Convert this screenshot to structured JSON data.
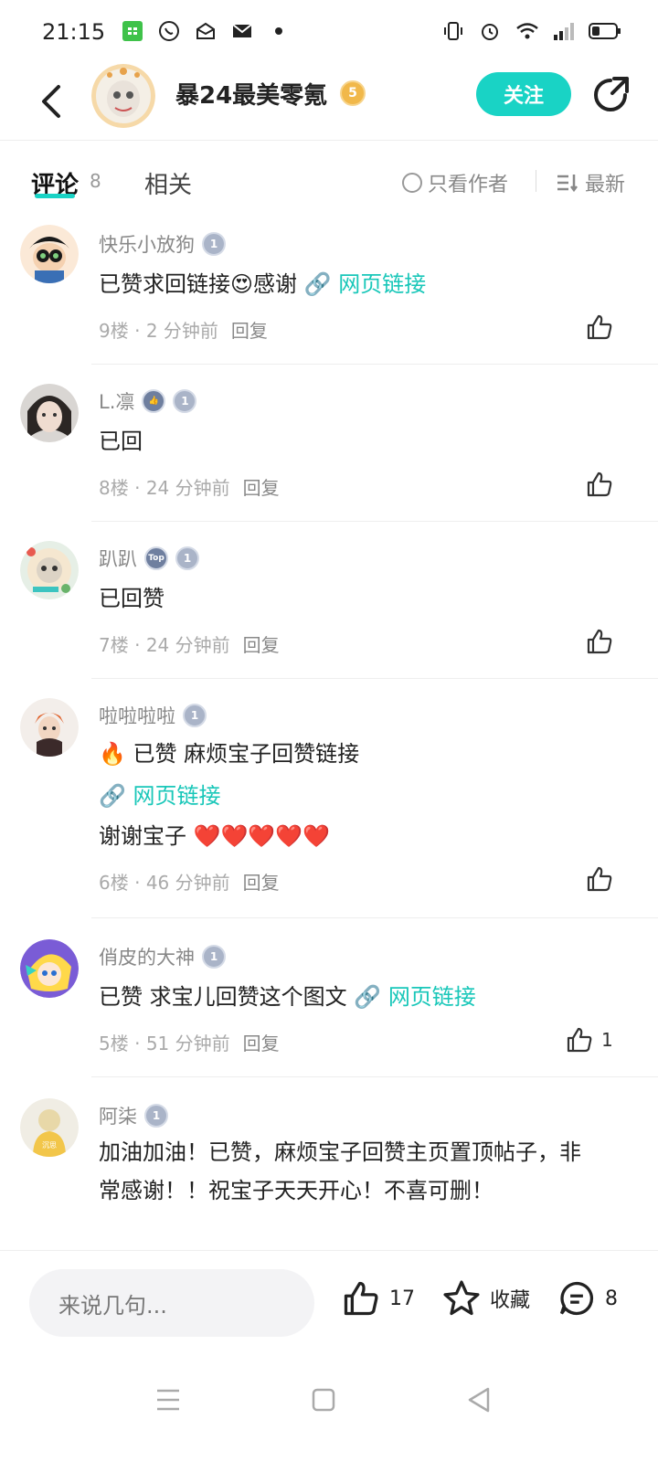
{
  "status_bar": {
    "time": "21:15",
    "left_icons": [
      "calculator-icon",
      "whatsapp-icon",
      "mail-open-icon",
      "mail-icon",
      "dot-icon"
    ],
    "right_icons": [
      "vibrate-icon",
      "alarm-icon",
      "wifi-icon",
      "signal-icon",
      "battery-icon"
    ]
  },
  "header": {
    "title": "暴24最美零氪",
    "level_badge": "5",
    "follow_label": "关注"
  },
  "tabs": {
    "comments_label": "评论",
    "comments_count": "8",
    "related_label": "相关",
    "only_author_label": "只看作者",
    "sort_label": "最新"
  },
  "comments": [
    {
      "name": "快乐小放狗",
      "badges": [
        "1"
      ],
      "body": "已赞求回链接😍感谢",
      "link_label": "网页链接",
      "floor": "9楼",
      "time": "2 分钟前",
      "reply": "回复",
      "likes": ""
    },
    {
      "name": "L.凛",
      "badges": [
        "like",
        "1"
      ],
      "body": "已回",
      "floor": "8楼",
      "time": "24 分钟前",
      "reply": "回复",
      "likes": ""
    },
    {
      "name": "趴趴",
      "badges": [
        "Top",
        "1"
      ],
      "body": "已回赞",
      "floor": "7楼",
      "time": "24 分钟前",
      "reply": "回复",
      "likes": ""
    },
    {
      "name": "啦啦啦啦",
      "badges": [
        "1"
      ],
      "body_line1": "🔥 已赞 麻烦宝子回赞链接",
      "link_label": "网页链接",
      "body_line3": "谢谢宝子 ❤️❤️❤️❤️❤️",
      "floor": "6楼",
      "time": "46 分钟前",
      "reply": "回复",
      "likes": ""
    },
    {
      "name": "俏皮的大神",
      "badges": [
        "1"
      ],
      "body": "已赞 求宝儿回赞这个图文",
      "link_label": "网页链接",
      "floor": "5楼",
      "time": "51 分钟前",
      "reply": "回复",
      "likes": "1"
    },
    {
      "name": "阿柒",
      "badges": [
        "1"
      ],
      "body": "加油加油！已赞，麻烦宝子回赞主页置顶帖子，非常感谢！！祝宝子天天开心！不喜可删！"
    }
  ],
  "bottom_bar": {
    "input_placeholder": "来说几句...",
    "like_count": "17",
    "favorite_label": "收藏",
    "comment_count": "8"
  },
  "colors": {
    "accent": "#19d3c5",
    "link": "#19c7b9"
  }
}
